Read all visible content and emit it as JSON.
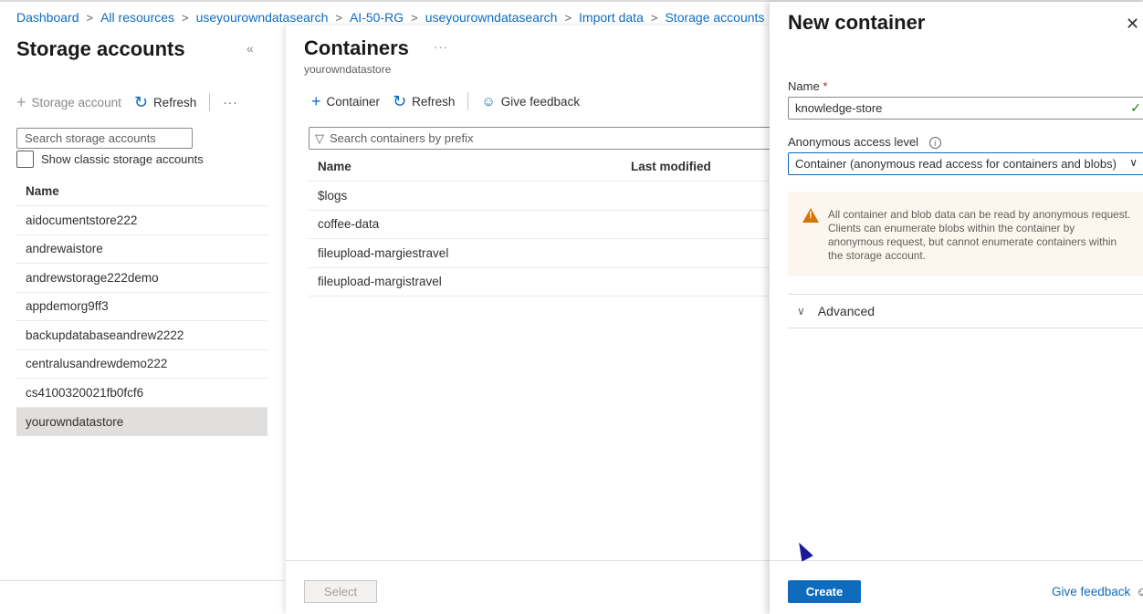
{
  "breadcrumb": [
    "Dashboard",
    "All resources",
    "useyourowndatasearch",
    "AI-50-RG",
    "useyourowndatasearch",
    "Import data",
    "Storage accounts"
  ],
  "storage_accounts": {
    "title": "Storage accounts",
    "toolbar": {
      "add_label": "Storage account",
      "refresh_label": "Refresh",
      "more": "···"
    },
    "search_placeholder": "Search storage accounts",
    "show_classic_label": "Show classic storage accounts",
    "column_name": "Name",
    "items": [
      "aidocumentstore222",
      "andrewaistore",
      "andrewstorage222demo",
      "appdemorg9ff3",
      "backupdatabaseandrew2222",
      "centralusandrewdemo222",
      "cs4100320021fb0fcf6",
      "yourowndatastore"
    ],
    "selected": "yourowndatastore"
  },
  "containers": {
    "title": "Containers",
    "more": "···",
    "subtitle": "yourowndatastore",
    "toolbar": {
      "add_label": "Container",
      "refresh_label": "Refresh",
      "feedback_label": "Give feedback"
    },
    "search_placeholder": "Search containers by prefix",
    "columns": [
      "Name",
      "Last modified"
    ],
    "items": [
      "$logs",
      "coffee-data",
      "fileupload-margiestravel",
      "fileupload-margistravel"
    ],
    "select_label": "Select"
  },
  "new_container": {
    "title": "New container",
    "name_label": "Name",
    "required_mark": "*",
    "name_value": "knowledge-store",
    "access_label": "Anonymous access level",
    "access_value": "Container (anonymous read access for containers and blobs)",
    "warning_text": "All container and blob data can be read by anonymous request. Clients can enumerate blobs within the container by anonymous request, but cannot enumerate containers within the storage account.",
    "advanced_label": "Advanced",
    "create_label": "Create",
    "feedback_label": "Give feedback"
  },
  "colors": {
    "accent": "#0f6cbd",
    "warning": "#d47500",
    "success": "#107c10"
  },
  "icons": [
    "chevron-right-icon",
    "collapse-icon",
    "plus-icon",
    "refresh-icon",
    "filter-icon",
    "feedback-icon",
    "close-icon",
    "check-icon",
    "info-icon",
    "warning-icon",
    "chevron-down-icon"
  ]
}
